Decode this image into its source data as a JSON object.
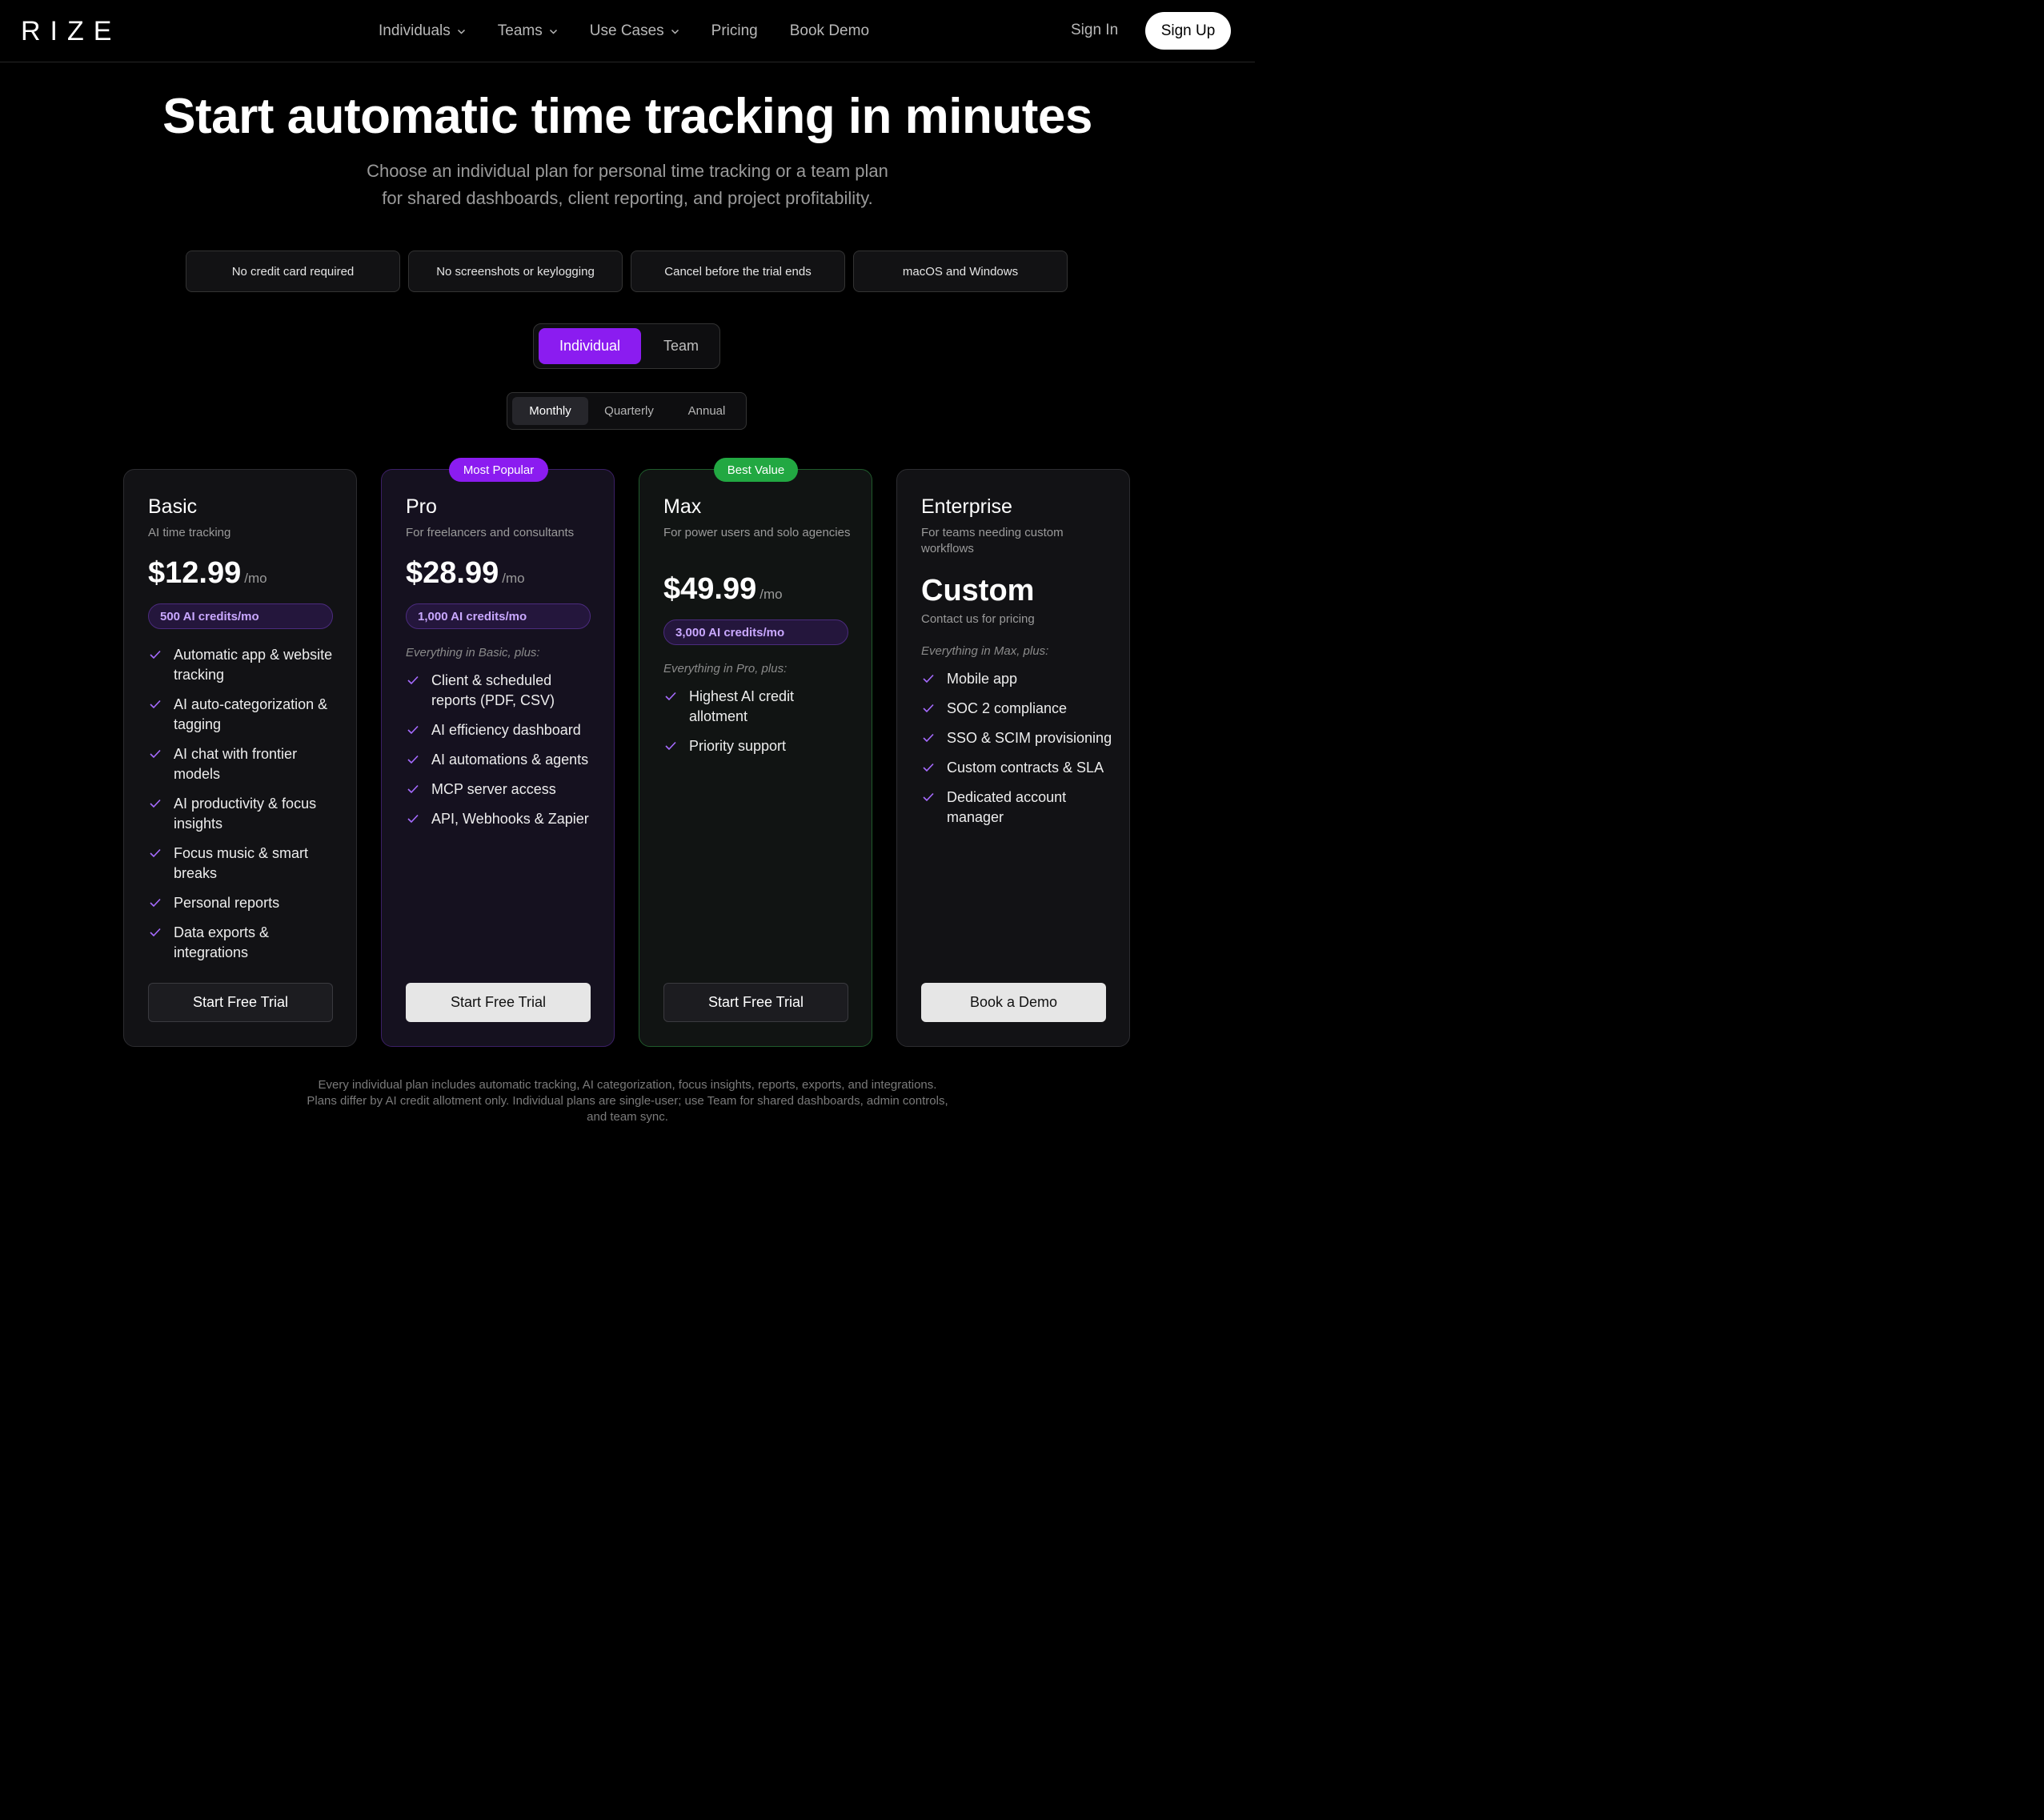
{
  "nav": {
    "logo": "RIZE",
    "links": [
      {
        "label": "Individuals",
        "dropdown": true
      },
      {
        "label": "Teams",
        "dropdown": true
      },
      {
        "label": "Use Cases",
        "dropdown": true
      },
      {
        "label": "Pricing",
        "dropdown": false
      },
      {
        "label": "Book Demo",
        "dropdown": false
      }
    ],
    "signin": "Sign In",
    "signup": "Sign Up"
  },
  "hero": {
    "title": "Start automatic time tracking in minutes",
    "subtitle_line1": "Choose an individual plan for personal time tracking or a team plan",
    "subtitle_line2": "for shared dashboards, client reporting, and project profitability."
  },
  "pills": [
    "No credit card required",
    "No screenshots or keylogging",
    "Cancel before the trial ends",
    "macOS and Windows"
  ],
  "plan_toggle": {
    "active": "Individual",
    "inactive": "Team"
  },
  "billing_toggle": {
    "monthly": "Monthly",
    "quarterly": "Quarterly",
    "annual": "Annual",
    "selected": "Monthly"
  },
  "plans": {
    "basic": {
      "name": "Basic",
      "desc": "AI time tracking",
      "price": "$12.99",
      "per": "/mo",
      "credits": "500 AI credits/mo",
      "features": [
        "Automatic app & website tracking",
        "AI auto-categorization & tagging",
        "AI chat with frontier models",
        "AI productivity & focus insights",
        "Focus music & smart breaks",
        "Personal reports",
        "Data exports & integrations"
      ],
      "button": "Start Free Trial"
    },
    "pro": {
      "badge": "Most Popular",
      "name": "Pro",
      "desc": "For freelancers and consultants",
      "price": "$28.99",
      "per": "/mo",
      "credits": "1,000 AI credits/mo",
      "everything": "Everything in Basic, plus:",
      "features": [
        "Client & scheduled reports (PDF, CSV)",
        "AI efficiency dashboard",
        "AI automations & agents",
        "MCP server access",
        "API, Webhooks & Zapier"
      ],
      "button": "Start Free Trial"
    },
    "max": {
      "badge": "Best Value",
      "name": "Max",
      "desc": "For power users and solo agencies",
      "price": "$49.99",
      "per": "/mo",
      "credits": "3,000 AI credits/mo",
      "everything": "Everything in Pro, plus:",
      "features": [
        "Highest AI credit allotment",
        "Priority support"
      ],
      "button": "Start Free Trial"
    },
    "enterprise": {
      "name": "Enterprise",
      "desc": "For teams needing custom workflows",
      "price": "Custom",
      "contact": "Contact us for pricing",
      "everything": "Everything in Max, plus:",
      "features": [
        "Mobile app",
        "SOC 2 compliance",
        "SSO & SCIM provisioning",
        "Custom contracts & SLA",
        "Dedicated account manager"
      ],
      "button": "Book a Demo"
    }
  },
  "footnote": {
    "line1": "Every individual plan includes automatic tracking, AI categorization, focus insights, reports, exports, and integrations.",
    "line2": "Plans differ by AI credit allotment only. Individual plans are single-user; use Team for shared dashboards, admin controls,",
    "line3": "and team sync."
  },
  "colors": {
    "accent_purple": "#8b1cf0",
    "badge_green": "#22a842",
    "check_purple": "#a66bff"
  }
}
